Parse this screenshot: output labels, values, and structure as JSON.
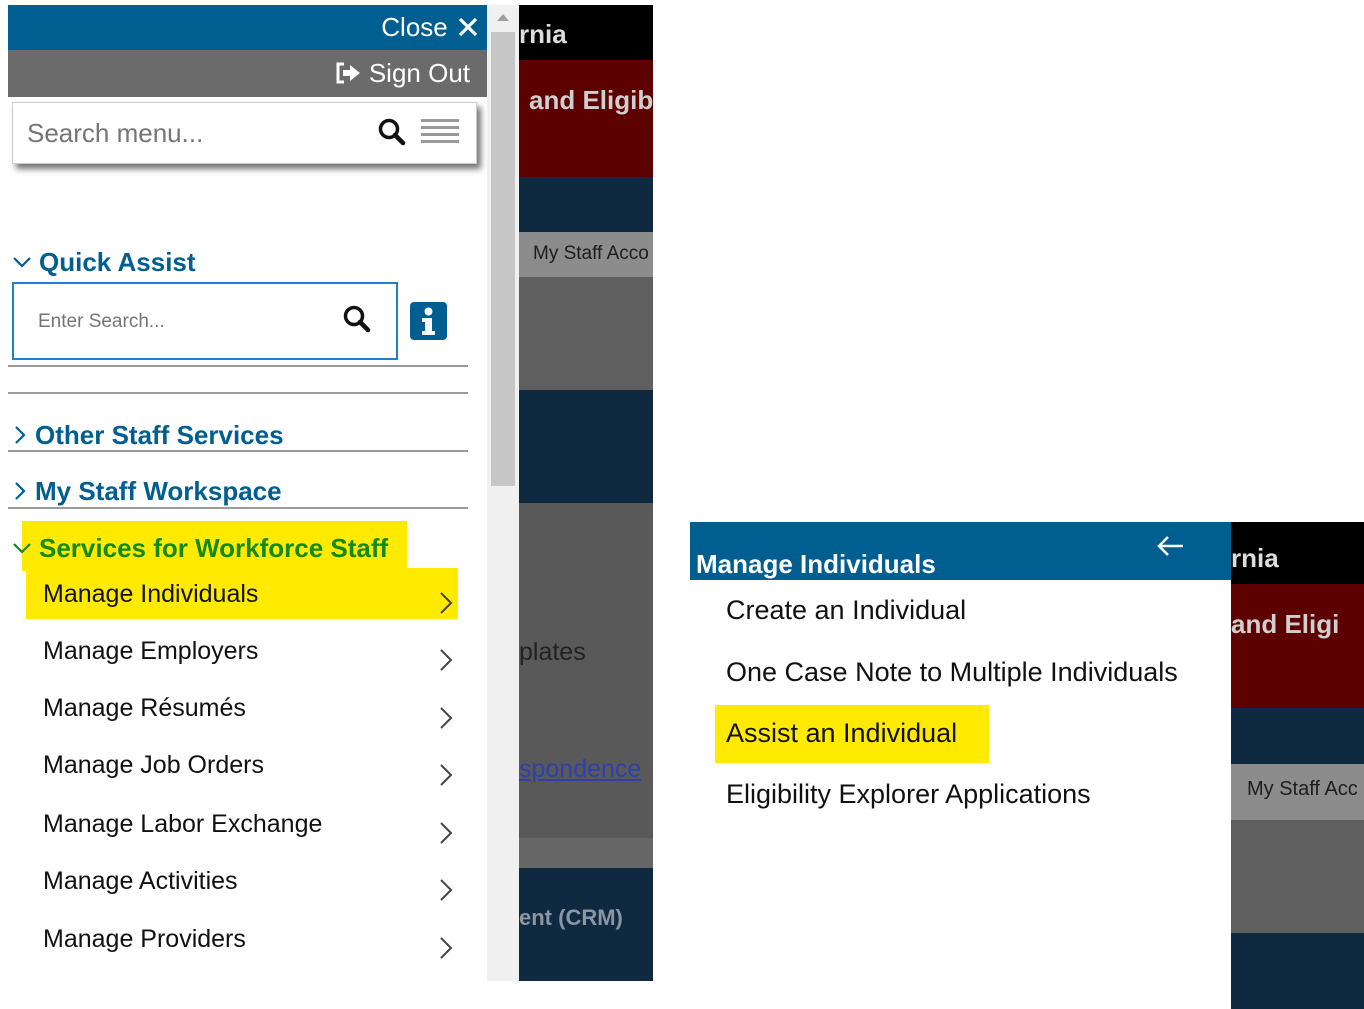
{
  "left_panel": {
    "close_label": "Close",
    "sign_out_label": "Sign Out",
    "search_menu": {
      "placeholder": "Search menu..."
    },
    "quick_assist": {
      "heading": "Quick Assist",
      "placeholder": "Enter Search..."
    },
    "sections": [
      {
        "label": "Other Staff Services",
        "expanded": false
      },
      {
        "label": "My Staff Workspace",
        "expanded": false
      },
      {
        "label": "Services for Workforce Staff",
        "expanded": true
      }
    ],
    "menu_items": [
      {
        "label": "Manage Individuals",
        "highlighted": true
      },
      {
        "label": "Manage Employers"
      },
      {
        "label": "Manage Résumés"
      },
      {
        "label": "Manage Job Orders"
      },
      {
        "label": "Manage Labor Exchange"
      },
      {
        "label": "Manage Activities"
      },
      {
        "label": "Manage Providers"
      }
    ],
    "colors": {
      "brand": "#005e91",
      "signout_bar": "#6b6b6b",
      "section_active": "#138a13",
      "highlight": "#ffea00"
    }
  },
  "left_background": {
    "title_fragment": "rnia",
    "banner_fragment": "and Eligib",
    "tab_fragment": "My Staff Acco",
    "templates_fragment": "plates",
    "link_fragment": "spondence",
    "crm_fragment": "ent (CRM)"
  },
  "right_panel": {
    "title": "Manage Individuals",
    "back_icon": "arrow-left-icon",
    "items": [
      {
        "label": "Create an Individual"
      },
      {
        "label": "One Case Note to Multiple Individuals"
      },
      {
        "label": "Assist an Individual",
        "highlighted": true
      },
      {
        "label": "Eligibility Explorer Applications"
      }
    ]
  },
  "right_background": {
    "title_fragment": "rnia",
    "banner_fragment": "and Eligi",
    "tab_fragment": "My Staff Acc"
  }
}
